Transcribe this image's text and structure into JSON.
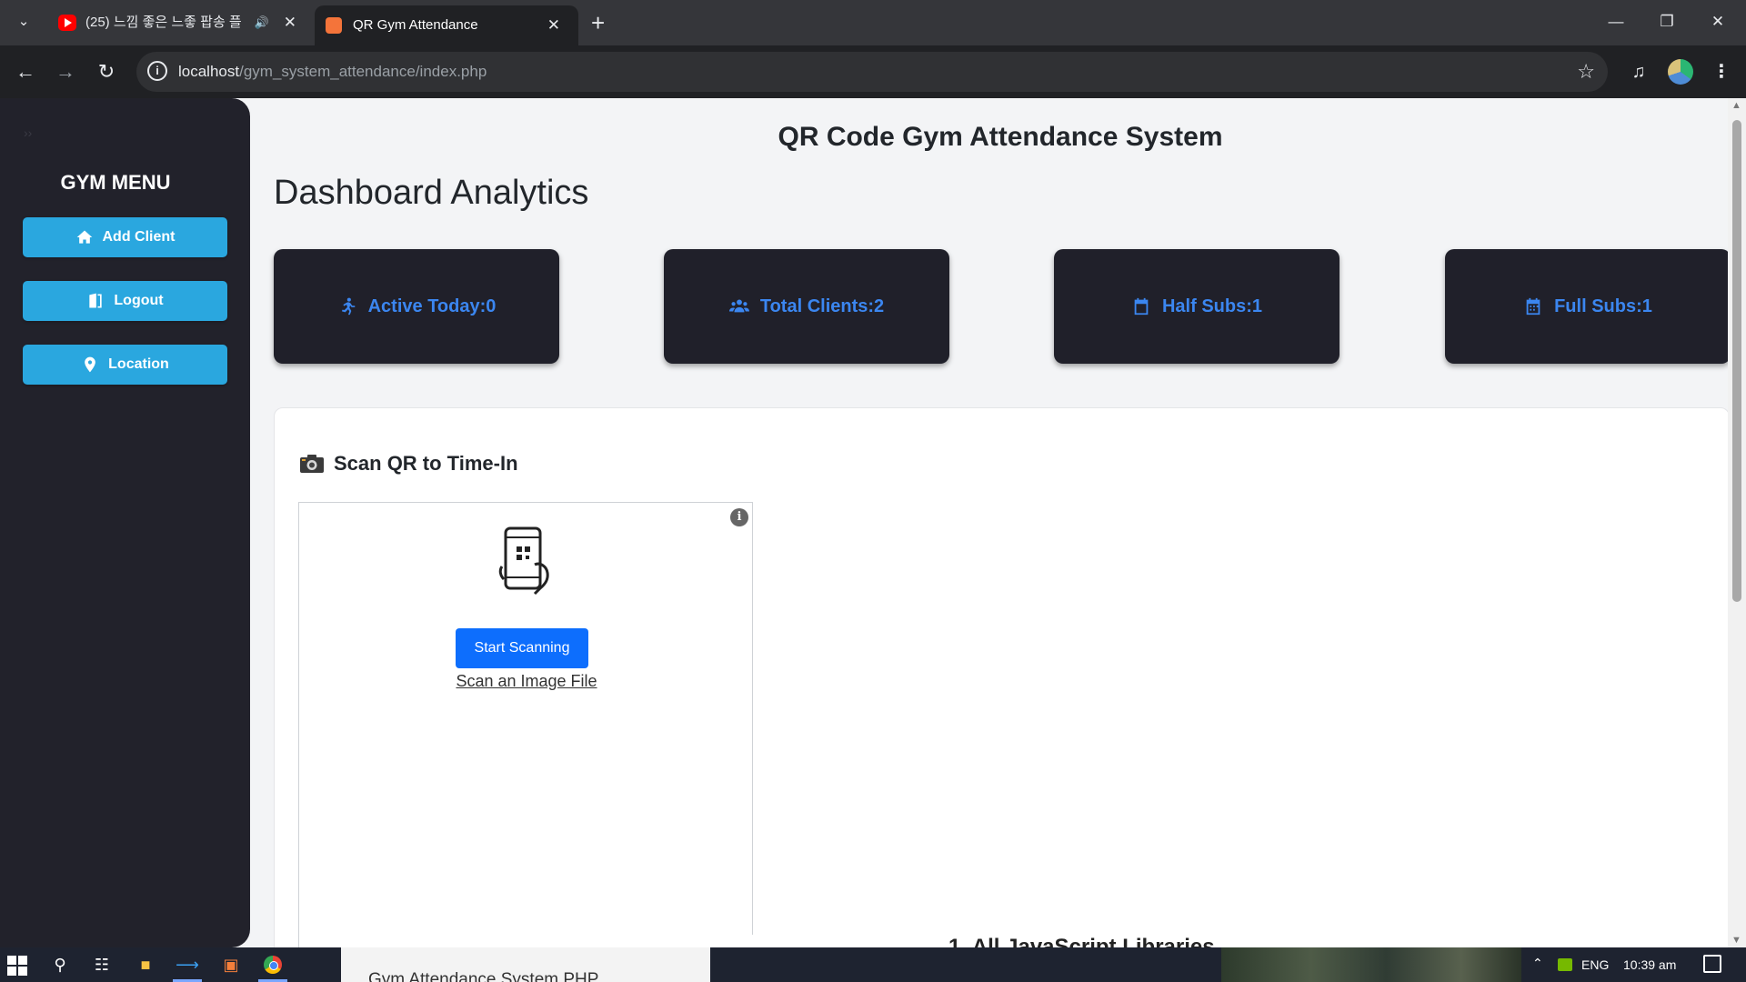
{
  "browser": {
    "tabs": [
      {
        "title": "(25) 느낌 좋은 느좋 팝송 플",
        "favicon": "youtube-icon",
        "audio": true,
        "active": false
      },
      {
        "title": "QR Gym Attendance",
        "favicon": "xampp-icon",
        "active": true
      }
    ],
    "url_host": "localhost",
    "url_path": "/gym_system_attendance/index.php"
  },
  "sidebar": {
    "title": "GYM MENU",
    "items": [
      {
        "label": "Add Client",
        "icon": "home-icon"
      },
      {
        "label": "Logout",
        "icon": "door-icon"
      },
      {
        "label": "Location",
        "icon": "map-pin-icon"
      }
    ]
  },
  "header": {
    "app_title": "QR Code Gym Attendance System",
    "page_title": "Dashboard Analytics"
  },
  "stats": [
    {
      "label": "Active Today:0",
      "icon": "running-icon"
    },
    {
      "label": "Total Clients:2",
      "icon": "users-icon"
    },
    {
      "label": "Half Subs:1",
      "icon": "calendar-icon"
    },
    {
      "label": "Full Subs:1",
      "icon": "calendar-icon"
    }
  ],
  "scanner": {
    "heading": "Scan QR to Time-In",
    "start_button": "Start Scanning",
    "file_link": "Scan an Image File"
  },
  "taskbar": {
    "background_window_title": "Gym Attendance System PHP",
    "background_doc_text": "1.  All JavaScript Libraries",
    "language": "ENG",
    "clock": "10:39 am"
  },
  "colors": {
    "accent_blue": "#2aa7df",
    "stat_text": "#3b86f0",
    "dark_panel": "#20202a",
    "primary_button": "#0d6efd"
  }
}
